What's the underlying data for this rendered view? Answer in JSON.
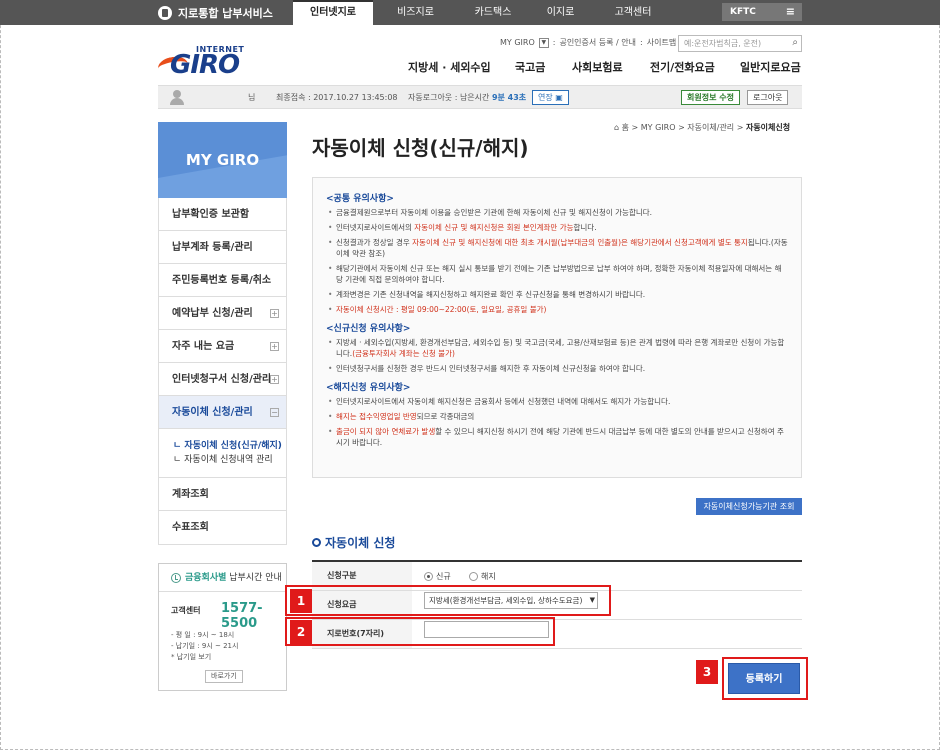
{
  "topbar": {
    "brand": "지로통합 납부서비스",
    "tabs": [
      "인터넷지로",
      "비즈지로",
      "카드택스",
      "이지로",
      "고객센터"
    ],
    "kftc": "KFTC"
  },
  "header": {
    "logo_internet": "INTERNET",
    "logo_giro": "GIRO",
    "util_mygiro": "MY GIRO",
    "util_cert": "공인인증서 등록 / 안내",
    "util_sitemap": "사이트맵",
    "search_placeholder": "예:운전자범칙금, 운전)",
    "gnb": [
      "지방세 · 세외수입",
      "국고금",
      "사회보험료",
      "전기/전화요금",
      "일반지로요금"
    ]
  },
  "loginbar": {
    "name_suffix": "님",
    "last_login": "최종접속 : 2017.10.27 13:45:08",
    "logout_prefix": "자동로그아웃 : 남은시간",
    "remaining": "9분 43초",
    "extend": "연장",
    "member_info": "회원정보 수정",
    "logout": "로그아웃"
  },
  "sidebar": {
    "title": "MY GIRO",
    "items": [
      {
        "label": "납부확인증 보관함",
        "plus": false
      },
      {
        "label": "납부계좌 등록/관리",
        "plus": false
      },
      {
        "label": "주민등록번호 등록/취소",
        "plus": false
      },
      {
        "label": "예약납부 신청/관리",
        "plus": true
      },
      {
        "label": "자주 내는 요금",
        "plus": true
      },
      {
        "label": "인터넷청구서 신청/관리",
        "plus": true
      },
      {
        "label": "자동이체 신청/관리",
        "plus": true
      }
    ],
    "sub": [
      "ㄴ 자동이체 신청(신규/해지)",
      "ㄴ 자동이체 신청내역 관리"
    ],
    "items2": [
      "계좌조회",
      "수표조회"
    ],
    "notice_title_prefix": "금융회사별",
    "notice_title_suffix": "납부시간 안내",
    "cc_label": "고객센터",
    "cc_number": "1577-5500",
    "hours": [
      "- 평    일 : 9시 ~ 18시",
      "- 납기일 : 9시 ~ 21시",
      "  * 납기일 보기"
    ],
    "go": "바로가기"
  },
  "content": {
    "breadcrumb": "홈 > MY GIRO > 자동이체/관리 > ",
    "breadcrumb_current": "자동이체신청",
    "title": "자동이체 신청(신규/해지)",
    "sections": [
      {
        "heading": "<공통 유의사항>",
        "lines": [
          {
            "pre": "금융결제원으로부터 자동이체 이용을 승인받은 기관에 한해 자동이체 신규 및 해지신청이 가능합니다.",
            "red": "",
            "post": ""
          },
          {
            "pre": "인터넷지로사이트에서의 ",
            "red": "자동이체 신규 및 해지신청은 회원 본인계좌만 가능",
            "post": "합니다."
          },
          {
            "pre": "신청결과가 정상일 경우 ",
            "red": "자동이체 신규 및 해지신청에 대한 최초 개시월(납부대금의 인출월)은 해당기관에서 신청고객에게 별도 통지",
            "post": "됩니다.(자동이체 약관 참조)"
          },
          {
            "pre": "해당기관에서 자동이체 신규 또는 해지 실시 통보를 받기 전에는 기존 납부방법으로 납부 하여야 하며, 정확한 자동이체 적용일자에 대해서는 해당 기관에 직접 문의하여야 합니다.",
            "red": "",
            "post": ""
          },
          {
            "pre": "계좌변경은 기존 신청내역을 해지신청하고 해지완료 확인 후 신규신청을 통해 변경하시기 바랍니다.",
            "red": "",
            "post": ""
          },
          {
            "pre": "",
            "red": "자동이체 신청시간 : 평일 09:00~22:00(토, 일요일, 공휴일 불가)",
            "post": ""
          }
        ]
      },
      {
        "heading": "<신규신청 유의사항>",
        "lines": [
          {
            "pre": "지방세 · 세외수입(지방세, 환경개선부담금, 세외수입 등) 및 국고금(국세, 고용/산재보험료 등)은 관계 법령에 따라 은행 계좌로만 신청이 가능합니다.",
            "red": "(금융투자회사 계좌는 신청 불가)",
            "post": ""
          },
          {
            "pre": "인터넷청구서를 신청한 경우 반드시 인터넷청구서를 해지한 후 자동이체 신규신청을 하여야 합니다.",
            "red": "",
            "post": ""
          }
        ]
      },
      {
        "heading": "<해지신청 유의사항>",
        "lines": [
          {
            "pre": "인터넷지로사이트에서 자동이체 해지신청은 금융회사 등에서 신청했던 내역에 대해서도 해지가 가능합니다.",
            "red": "",
            "post": ""
          },
          {
            "pre": "",
            "red": "해지는 접수익영업일 반영",
            "post": "되므로 각종대금의 "
          },
          {
            "pre": "",
            "red": "출금이 되지 않아 연체료가 발생",
            "post": "할 수 있으니 해지신청 하시기 전에 해당 기관에 반드시 대금납부 등에 대한 별도의 안내를 받으시고 신청하여 주시기 바랍니다."
          }
        ]
      }
    ],
    "avail_button": "자동이체신청가능기관 조회",
    "form_title": "자동이체 신청",
    "form": {
      "type_label": "신청구분",
      "type_new": "신규",
      "type_cancel": "해지",
      "fee_label": "신청요금",
      "fee_value": "지방세(환경개선부담금, 세외수입, 상하수도요금)",
      "giro_label": "지로번호(7자리)",
      "giro_value": ""
    },
    "submit": "등록하기",
    "annotations": [
      "1",
      "2",
      "3"
    ]
  }
}
